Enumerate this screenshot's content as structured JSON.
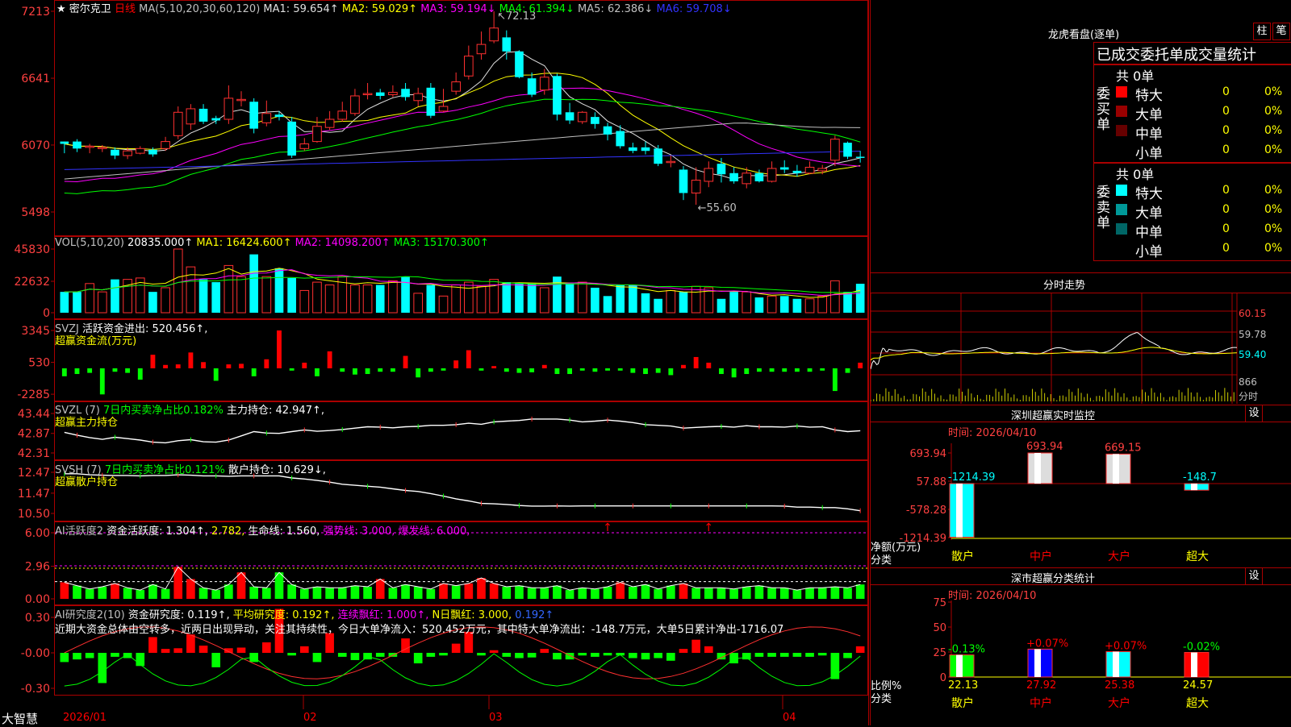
{
  "stock": {
    "prefix": "★",
    "name": "密尔克卫",
    "period": "日线"
  },
  "ma_header": [
    {
      "t": "MA(5,10,20,30,60,120)",
      "c": "#c0c0c0"
    },
    {
      "t": "MA1: 59.654↑",
      "c": "#e0e0e0"
    },
    {
      "t": "MA2: 59.029↑",
      "c": "#ffff00"
    },
    {
      "t": "MA3: 59.194↓",
      "c": "#ff00ff"
    },
    {
      "t": "MA4: 61.394↓",
      "c": "#00ff00"
    },
    {
      "t": "MA5: 62.386↓",
      "c": "#c0c0c0"
    },
    {
      "t": "MA6: 59.708↓",
      "c": "#3333ff"
    }
  ],
  "price_axis": [
    "7213",
    "6641",
    "6070",
    "5498"
  ],
  "price_hi": "72.13",
  "price_lo": "←55.60",
  "vol_header": [
    {
      "t": "VOL(5,10,20)",
      "c": "#c0c0c0"
    },
    {
      "t": "20835.000↑",
      "c": "#ffffff"
    },
    {
      "t": "MA1: 16424.600↑",
      "c": "#ffff00"
    },
    {
      "t": "MA2: 14098.200↑",
      "c": "#ff00ff"
    },
    {
      "t": "MA3: 15170.300↑",
      "c": "#00ff00"
    }
  ],
  "vol_axis": [
    "45830",
    "22632",
    "0"
  ],
  "svzj": {
    "line1": [
      {
        "t": "SVZJ",
        "c": "#c0c0c0"
      },
      {
        "t": "活跃资金进出: 520.456↑,",
        "c": "#ffffff"
      }
    ],
    "line2": "超赢资金流(万元)",
    "axis": [
      "3345",
      "530",
      "-2285"
    ]
  },
  "svzl": {
    "line1": [
      {
        "t": "SVZL (7)",
        "c": "#c0c0c0"
      },
      {
        "t": "7日内买卖净占比0.182%",
        "c": "#00ff00"
      },
      {
        "t": "主力持仓: 42.947↑,",
        "c": "#ffffff"
      }
    ],
    "line2": "超赢主力持仓",
    "axis": [
      "43.44",
      "42.87",
      "42.31"
    ]
  },
  "svsh": {
    "line1": [
      {
        "t": "SVSH (7)",
        "c": "#c0c0c0"
      },
      {
        "t": "7日内买卖净占比0.121%",
        "c": "#00ff00"
      },
      {
        "t": "散户持仓: 10.629↓,",
        "c": "#ffffff"
      }
    ],
    "line2": "超赢散户持仓",
    "axis": [
      "12.47",
      "11.47",
      "10.50"
    ]
  },
  "ai2": {
    "line1": [
      {
        "t": "AI活跃度2",
        "c": "#c0c0c0"
      },
      {
        "t": "资金活跃度: 1.304↑,",
        "c": "#ffffff"
      },
      {
        "t": "2.782,",
        "c": "#ffff00"
      },
      {
        "t": "生命线: 1.560,",
        "c": "#ffffff"
      },
      {
        "t": "强势线: 3.000,",
        "c": "#ff00ff"
      },
      {
        "t": "爆发线: 6.000,",
        "c": "#ff00ff"
      }
    ],
    "axis": [
      "6.00",
      "2.96",
      "0.00"
    ]
  },
  "ai3": {
    "line1": [
      {
        "t": "AI研究度2(10)",
        "c": "#c0c0c0"
      },
      {
        "t": "资金研究度: 0.119↑,",
        "c": "#ffffff"
      },
      {
        "t": "平均研究度: 0.192↑,",
        "c": "#ffff00"
      },
      {
        "t": "连续飘红: 1.000↑,",
        "c": "#ff00ff"
      },
      {
        "t": "N日飘红: 3.000,",
        "c": "#ffff00"
      },
      {
        "t": "0.192↑",
        "c": "#3366ff"
      }
    ],
    "line2": "近期大资金总体由空转多，近两日出现异动，关注其持续性，今日大单净流入：520.452万元，其中特大单净流出：-148.7万元，大单5日累计净出-1716.07",
    "axis": [
      "0.30",
      "-0.00",
      "-0.30"
    ]
  },
  "date_axis": {
    "brand": "大智慧",
    "labels": [
      "2026/01",
      "02",
      "03",
      "04"
    ]
  },
  "lhb": {
    "title": "龙虎看盘(逐单)",
    "btn1": "柱",
    "btn2": "笔",
    "header": "已成交委托单成交量统计",
    "buy": {
      "side": "委买单",
      "total": "共 0单",
      "rows": [
        {
          "name": "特大",
          "qty": "0",
          "pct": "0%",
          "color": "#ff0000"
        },
        {
          "name": "大单",
          "qty": "0",
          "pct": "0%",
          "color": "#990000"
        },
        {
          "name": "中单",
          "qty": "0",
          "pct": "0%",
          "color": "#660000"
        },
        {
          "name": "小单",
          "qty": "0",
          "pct": "0%",
          "color": "#000000"
        }
      ]
    },
    "sell": {
      "side": "委卖单",
      "total": "共 0单",
      "rows": [
        {
          "name": "特大",
          "qty": "0",
          "pct": "0%",
          "color": "#00ffff"
        },
        {
          "name": "大单",
          "qty": "0",
          "pct": "0%",
          "color": "#009999"
        },
        {
          "name": "中单",
          "qty": "0",
          "pct": "0%",
          "color": "#006666"
        },
        {
          "name": "小单",
          "qty": "0",
          "pct": "0%",
          "color": "#000000"
        }
      ]
    }
  },
  "intraday": {
    "title": "分时走势",
    "axis": [
      "60.15",
      "59.78",
      "59.40"
    ],
    "vol": "866",
    "unit": "分时"
  },
  "sz_monitor": {
    "title": "深圳超赢实时监控",
    "btn": "设",
    "time": "时间: 2026/04/10",
    "axis": [
      "693.94",
      "57.88",
      "-578.28",
      "-1214.39"
    ],
    "unit1": "净额(万元)",
    "unit2": "分类",
    "bars": [
      {
        "cat": "散户",
        "label": "-1214.39",
        "value": -1214.39,
        "color": "#00ffff",
        "cat_color": "#ffff00"
      },
      {
        "cat": "中户",
        "label": "693.94",
        "value": 693.94,
        "color": "#dddddd",
        "cat_color": "#ff0000"
      },
      {
        "cat": "大户",
        "label": "669.15",
        "value": 669.15,
        "color": "#dddddd",
        "cat_color": "#ff0000"
      },
      {
        "cat": "超大",
        "label": "-148.7",
        "value": -148.7,
        "color": "#00ffff",
        "cat_color": "#ffff00"
      }
    ]
  },
  "sz_class": {
    "title": "深市超赢分类统计",
    "btn": "设",
    "time": "时间: 2026/04/10",
    "axis": [
      "75",
      "50",
      "25",
      "0"
    ],
    "unit1": "比例%",
    "unit2": "分类",
    "bars": [
      {
        "cat": "散户",
        "pct": "22.13",
        "value": 22.13,
        "chg": "-0.13%",
        "chg_color": "#00ff00",
        "color": "#00ff00",
        "cat_color": "#ffff00"
      },
      {
        "cat": "中户",
        "pct": "27.92",
        "value": 27.92,
        "chg": "+0.07%",
        "chg_color": "#ff0000",
        "color": "#0000ff",
        "cat_color": "#ff0000"
      },
      {
        "cat": "大户",
        "pct": "25.38",
        "value": 25.38,
        "chg": "+0.07%",
        "chg_color": "#ff0000",
        "color": "#00ffff",
        "cat_color": "#ff0000"
      },
      {
        "cat": "超大",
        "pct": "24.57",
        "value": 24.57,
        "chg": "-0.02%",
        "chg_color": "#00ff00",
        "color": "#ff0000",
        "cat_color": "#ffff00"
      }
    ]
  },
  "chart_data": {
    "type": "candlestick",
    "candles": [
      [
        61,
        60.8,
        60.2,
        61,
        60
      ],
      [
        61,
        60.4,
        60.4,
        61.2,
        60.1
      ],
      [
        60.5,
        60.6,
        60.2,
        60.8,
        60
      ],
      [
        60.4,
        60.5,
        60.2,
        60.7,
        60.1
      ],
      [
        60.3,
        59.8,
        59.6,
        60.5,
        59.5
      ],
      [
        59.8,
        60.2,
        59.6,
        60.5,
        59.5
      ],
      [
        60,
        60.4,
        60.1,
        60.6,
        59.9
      ],
      [
        60.3,
        59.9,
        60.3,
        60.5,
        59.7
      ],
      [
        60.4,
        61,
        61,
        61.4,
        60.2
      ],
      [
        61.5,
        63.5,
        63.5,
        64,
        61.2
      ],
      [
        62.5,
        63.8,
        63.8,
        64.2,
        62
      ],
      [
        63.8,
        62.7,
        63.8,
        64.2,
        62.5
      ],
      [
        63,
        62.8,
        62.7,
        63.2,
        62.5
      ],
      [
        62.9,
        64.7,
        64.7,
        65.8,
        62.5
      ],
      [
        64.5,
        64.6,
        64.6,
        65.3,
        64
      ],
      [
        64.4,
        62.1,
        64.4,
        64.7,
        61.7
      ],
      [
        62.6,
        63.4,
        63.4,
        64.5,
        62.3
      ],
      [
        63.3,
        63.1,
        63.1,
        63.6,
        62.8
      ],
      [
        62.7,
        59.8,
        62.7,
        63.1,
        59.6
      ],
      [
        60.4,
        60.8,
        60.8,
        61.3,
        60.2
      ],
      [
        61,
        62.3,
        62.3,
        63.1,
        60.9
      ],
      [
        62.2,
        62.9,
        62.9,
        63.6,
        62
      ],
      [
        62.9,
        63.6,
        63.6,
        64.4,
        62.7
      ],
      [
        63.4,
        64.9,
        64.9,
        65.5,
        63.2
      ],
      [
        65,
        65.1,
        65.1,
        66,
        64.6
      ],
      [
        65.2,
        64.9,
        65.2,
        65.5,
        64.6
      ],
      [
        65,
        65.2,
        65.2,
        65.8,
        64.8
      ],
      [
        65.5,
        64.8,
        65.5,
        66,
        64.5
      ],
      [
        64.5,
        65.1,
        65.1,
        65.6,
        64
      ],
      [
        65.6,
        63.2,
        65.6,
        66,
        63
      ],
      [
        63.6,
        64,
        64,
        65.5,
        63.5
      ],
      [
        65.3,
        66.1,
        66.1,
        66.9,
        65
      ],
      [
        66.6,
        68.3,
        68.3,
        69.2,
        66.3
      ],
      [
        68.5,
        69.3,
        69.3,
        70.4,
        68
      ],
      [
        69.6,
        70.7,
        70.7,
        72.13,
        69.4
      ],
      [
        69.9,
        68.7,
        69.9,
        70.5,
        68
      ],
      [
        68.7,
        66.5,
        68.7,
        68.8,
        66.4
      ],
      [
        66.4,
        65,
        66.4,
        66.9,
        64.8
      ],
      [
        65.4,
        66.5,
        66.5,
        67.2,
        65
      ],
      [
        66.6,
        63.3,
        66.6,
        66.8,
        62.8
      ],
      [
        63.5,
        62.8,
        63.5,
        64.3,
        62.5
      ],
      [
        62.7,
        63.5,
        63.1,
        63.6,
        62.5
      ],
      [
        63.1,
        62.5,
        63.1,
        63.5,
        62.1
      ],
      [
        62.3,
        61.6,
        62.1,
        62.6,
        61.1
      ],
      [
        61.9,
        60.6,
        61.9,
        62.4,
        60.4
      ],
      [
        60.5,
        60.2,
        60.7,
        60.9,
        60
      ],
      [
        60.5,
        60.2,
        60.6,
        61,
        59.9
      ],
      [
        60.4,
        59.1,
        60.4,
        60.7,
        58.9
      ],
      [
        59.2,
        59.3,
        59.3,
        59.8,
        58.8
      ],
      [
        58.6,
        56.6,
        58.6,
        58.9,
        56
      ],
      [
        56.6,
        57.7,
        57.7,
        58.8,
        55.6
      ],
      [
        57.6,
        58.7,
        58.7,
        59.3,
        57.1
      ],
      [
        59.1,
        58.2,
        59.1,
        59.6,
        57.5
      ],
      [
        58.3,
        57.6,
        58.3,
        58.8,
        57.4
      ],
      [
        57.4,
        58.3,
        58.3,
        58.8,
        57
      ],
      [
        58.3,
        57.6,
        58.3,
        58.6,
        57.5
      ],
      [
        57.6,
        58.7,
        58.7,
        59.3,
        57.5
      ],
      [
        58.8,
        58.6,
        58.8,
        59.4,
        58.3
      ],
      [
        58.5,
        58.3,
        58.6,
        59,
        58
      ],
      [
        58.3,
        58.8,
        58.8,
        59.3,
        58.2
      ],
      [
        58.5,
        58.7,
        58.6,
        59,
        58.2
      ],
      [
        59.4,
        61.2,
        61.2,
        61.5,
        58.9
      ],
      [
        60.9,
        59.7,
        60.9,
        61,
        59.5
      ],
      [
        59.7,
        59.6,
        59.9,
        60.2,
        59.2
      ]
    ],
    "volume": [
      15000,
      15000,
      21000,
      15000,
      24000,
      24000,
      25000,
      15000,
      18000,
      45830,
      33000,
      24000,
      22000,
      34000,
      26000,
      42000,
      26000,
      32000,
      25000,
      16000,
      22000,
      20000,
      26000,
      20000,
      20000,
      20000,
      23000,
      26000,
      14000,
      20000,
      12000,
      20000,
      22000,
      19000,
      24000,
      22000,
      21000,
      21000,
      18000,
      26000,
      21000,
      22000,
      18000,
      12000,
      20000,
      20000,
      14000,
      10000,
      16000,
      15000,
      19000,
      18000,
      10000,
      15000,
      15000,
      11000,
      12000,
      12000,
      10000,
      10000,
      12000,
      23000,
      15000,
      20835
    ],
    "svzj": [
      -700,
      -500,
      -400,
      -2300,
      -300,
      -400,
      -1000,
      1200,
      300,
      350,
      1400,
      550,
      -1100,
      350,
      400,
      -700,
      800,
      3345,
      -200,
      500,
      -700,
      1500,
      -300,
      -550,
      -500,
      -300,
      -300,
      1100,
      -800,
      -300,
      -200,
      700,
      1600,
      -200,
      200,
      -300,
      -400,
      -350,
      300,
      -500,
      -500,
      -200,
      -300,
      -200,
      -200,
      -400,
      -500,
      -400,
      -600,
      300,
      1000,
      500,
      -500,
      -800,
      -500,
      -300,
      -300,
      -300,
      -300,
      -300,
      -200,
      -2000,
      -400,
      500
    ],
    "svzl": [
      42.9,
      42.82,
      42.75,
      42.7,
      42.76,
      42.72,
      42.68,
      42.62,
      42.6,
      42.66,
      42.69,
      42.63,
      42.62,
      42.68,
      42.8,
      42.92,
      42.88,
      42.87,
      42.92,
      42.97,
      42.93,
      42.95,
      42.98,
      43.02,
      43.06,
      43.05,
      43.03,
      43.06,
      43.07,
      43.1,
      43.1,
      43.12,
      43.16,
      43.13,
      43.2,
      43.22,
      43.24,
      43.28,
      43.28,
      43.28,
      43.25,
      43.2,
      43.22,
      43.25,
      43.22,
      43.18,
      43.12,
      43.1,
      43.08,
      43.02,
      43.04,
      43.06,
      43.07,
      43.05,
      43.09,
      43.06,
      43.06,
      43.05,
      43.08,
      43.05,
      43.06,
      42.97,
      42.92,
      42.947
    ],
    "svsh": [
      12.4,
      12.4,
      12.35,
      12.33,
      12.32,
      12.32,
      12.3,
      12.32,
      12.32,
      12.35,
      12.33,
      12.3,
      12.3,
      12.28,
      12.3,
      12.3,
      12.3,
      12.3,
      12.2,
      12.15,
      12.08,
      12.0,
      11.9,
      11.85,
      11.8,
      11.76,
      11.68,
      11.6,
      11.55,
      11.45,
      11.33,
      11.2,
      11.1,
      10.98,
      10.96,
      10.93,
      10.88,
      10.85,
      10.85,
      10.86,
      10.85,
      10.86,
      10.86,
      10.86,
      10.86,
      10.86,
      10.86,
      10.86,
      10.86,
      10.86,
      10.86,
      10.86,
      10.86,
      10.86,
      10.86,
      10.86,
      10.86,
      10.85,
      10.8,
      10.8,
      10.78,
      10.78,
      10.72,
      10.629
    ],
    "ai2": [
      1.5,
      1.2,
      0.9,
      1.1,
      1.4,
      1.0,
      0.8,
      1.3,
      0.9,
      1.5,
      1.8,
      1.0,
      0.8,
      1.3,
      1.7,
      1.1,
      1.0,
      1.0,
      1.3,
      0.9,
      1.1,
      1.0,
      1.0,
      1.2,
      1.1,
      1.8,
      1.0,
      1.3,
      1.1,
      0.9,
      1.4,
      1.2,
      1.4,
      1.9,
      1.4,
      1.1,
      1.2,
      1.0,
      1.0,
      1.2,
      0.8,
      1.0,
      0.9,
      1.1,
      1.5,
      1.1,
      1.3,
      0.9,
      1.2,
      1.4,
      1.0,
      1.0,
      1.0,
      0.9,
      1.1,
      1.2,
      1.0,
      1.0,
      0.8,
      1.0,
      1.0,
      1.1,
      1.0,
      1.304
    ]
  }
}
